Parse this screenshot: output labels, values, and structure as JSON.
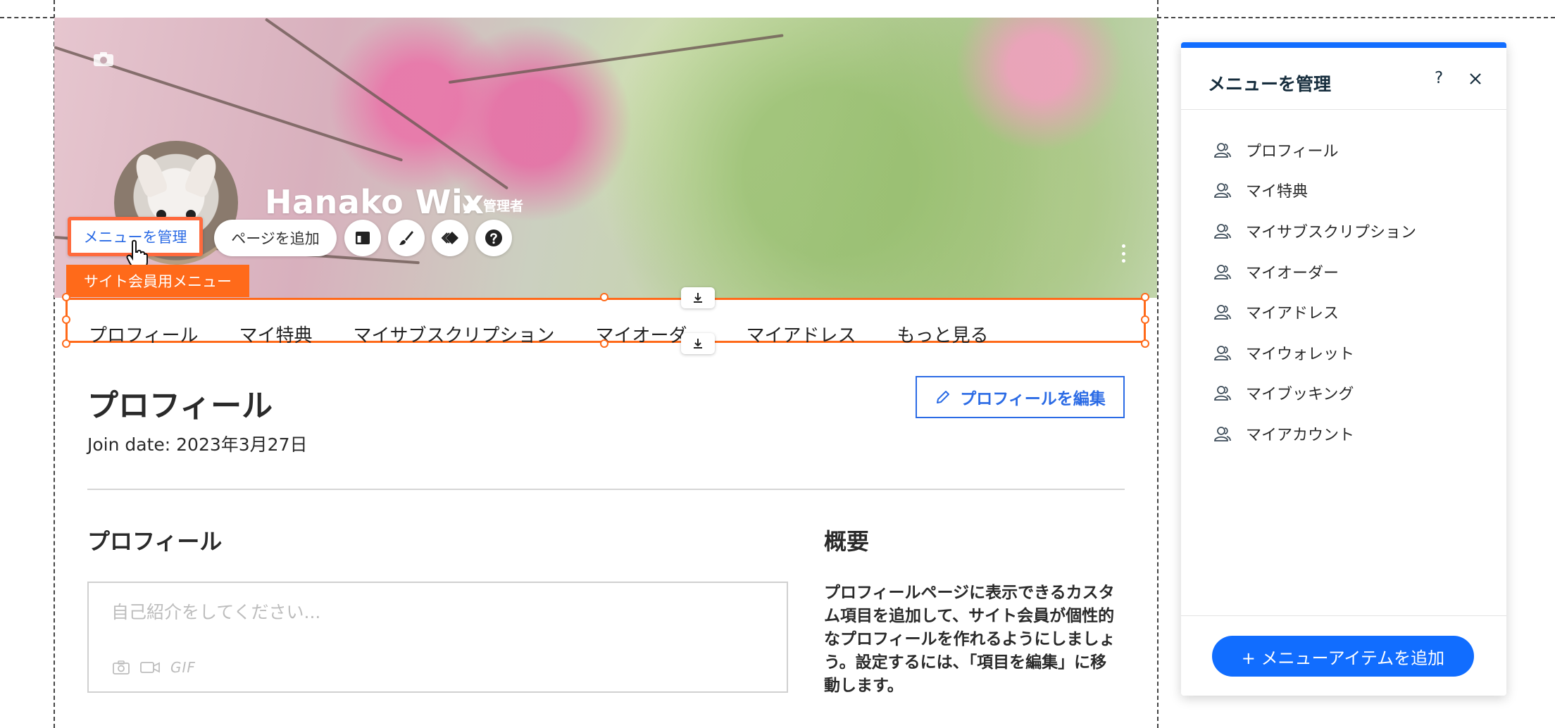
{
  "member": {
    "name": "Hanako Wix",
    "role_badge": "管理者"
  },
  "toolbar": {
    "manage_menu_label": "メニューを管理",
    "add_page_label": "ページを追加"
  },
  "menu": {
    "tag_label": "サイト会員用メニュー",
    "items": [
      "プロフィール",
      "マイ特典",
      "マイサブスクリプション",
      "マイオーダー",
      "マイアドレス",
      "もっと見る"
    ]
  },
  "profile": {
    "page_title": "プロフィール",
    "join_date": "Join date: 2023年3月27日",
    "edit_button": "プロフィールを編集",
    "section_profile": "プロフィール",
    "bio_placeholder": "自己紹介をしてください...",
    "gif_label": "GIF",
    "section_about": "概要",
    "about_text": "プロフィールページに表示できるカスタム項目を追加して、サイト会員が個性的なプロフィールを作れるようにしましょう。設定するには、「項目を編集」に移動します。"
  },
  "panel": {
    "title": "メニューを管理",
    "help_label": "?",
    "items": [
      "プロフィール",
      "マイ特典",
      "マイサブスクリプション",
      "マイオーダー",
      "マイアドレス",
      "マイウォレット",
      "マイブッキング",
      "マイアカウント"
    ],
    "add_button": "+ メニューアイテムを追加"
  },
  "colors": {
    "accent_blue": "#116dff",
    "link_blue": "#2b6be5",
    "selection_orange": "#ff6a1a"
  }
}
